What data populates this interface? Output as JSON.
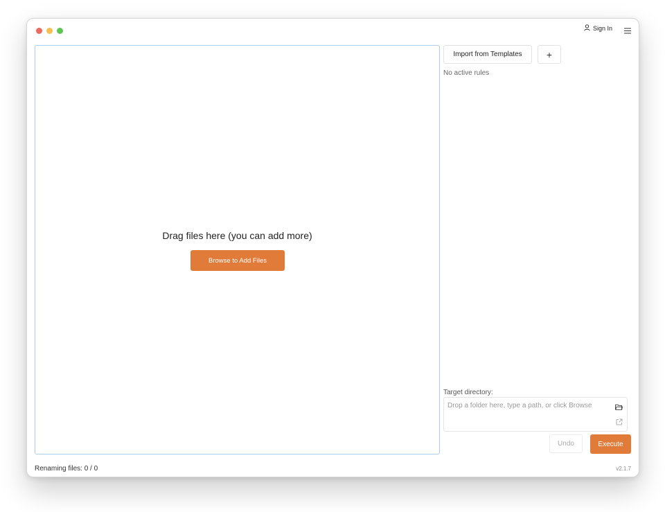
{
  "header": {
    "sign_in_label": "Sign In",
    "user_icon": "user-icon",
    "menu_icon": "hamburger-menu-icon"
  },
  "dropzone": {
    "prompt": "Drag files here (you can add more)",
    "browse_label": "Browse to Add Files"
  },
  "rules": {
    "import_label": "Import from Templates",
    "add_label": "+",
    "empty_text": "No active rules"
  },
  "target": {
    "label": "Target directory:",
    "placeholder": "Drop a folder here, type a path, or click Browse",
    "value": ""
  },
  "actions": {
    "undo_label": "Undo",
    "execute_label": "Execute"
  },
  "footer": {
    "status_text": "Renaming files: 0 / 0",
    "version": "v2.1.7"
  },
  "colors": {
    "accent": "#e07b3a",
    "dropzone_border": "#a9cdeb"
  }
}
